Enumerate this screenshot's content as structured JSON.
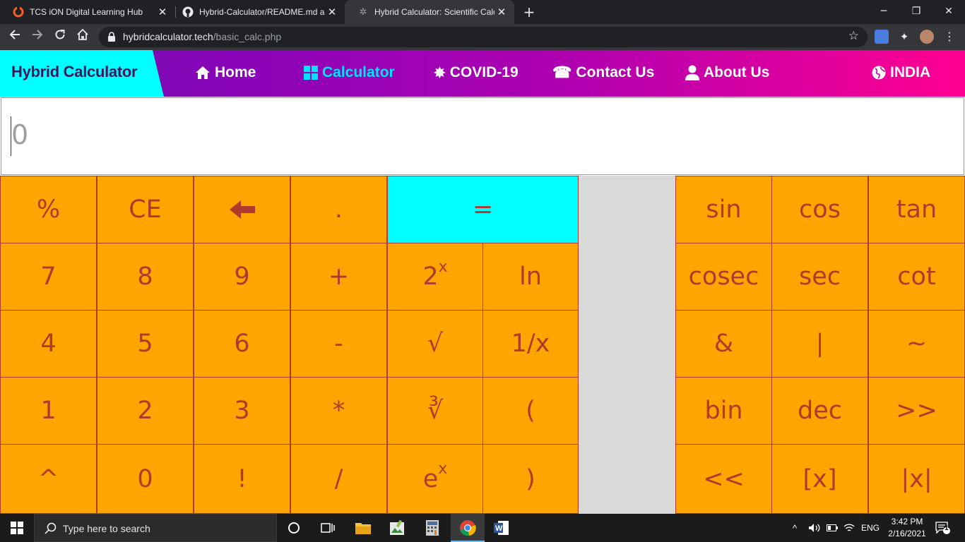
{
  "browser": {
    "tabs": [
      {
        "title": "TCS iON Digital Learning Hub",
        "favicon": "tcs-ion-icon"
      },
      {
        "title": "Hybrid-Calculator/README.md a",
        "favicon": "github-icon"
      },
      {
        "title": "Hybrid Calculator: Scientific Calcu",
        "favicon": "site-icon",
        "active": true
      }
    ],
    "new_tab": "+",
    "url_domain": "hybridcalculator.tech",
    "url_path": "/basic_calc.php",
    "window_controls": [
      "─",
      "❐",
      "✕"
    ]
  },
  "site": {
    "brand": "Hybrid Calculator",
    "nav": [
      {
        "label": "Home",
        "icon": "home-icon"
      },
      {
        "label": "Calculator",
        "icon": "grid-icon",
        "active": true
      },
      {
        "label": "COVID-19",
        "icon": "virus-icon"
      },
      {
        "label": "Contact Us",
        "icon": "phone-icon"
      },
      {
        "label": "About Us",
        "icon": "user-icon"
      },
      {
        "label": "INDIA",
        "icon": "globe-icon"
      }
    ],
    "display_value": "0",
    "colors": {
      "key_bg": "#ffa500",
      "key_text": "#b03a2e",
      "equals_bg": "#00ffff",
      "brand_bg": "#00ffff",
      "active_nav": "#00e5ff"
    }
  },
  "keys": {
    "row1": [
      "%",
      "CE",
      "backspace",
      ".",
      "="
    ],
    "row2": [
      "7",
      "8",
      "9",
      "+",
      "2",
      "ln"
    ],
    "row2_sup": "x",
    "row3": [
      "4",
      "5",
      "6",
      "-",
      "√",
      "1/x"
    ],
    "row4": [
      "1",
      "2",
      "3",
      "*",
      "∛",
      "("
    ],
    "row5": [
      "^",
      "0",
      "!",
      "/",
      "e",
      ")"
    ],
    "row5_sup": "x",
    "sci": [
      [
        "sin",
        "cos",
        "tan"
      ],
      [
        "cosec",
        "sec",
        "cot"
      ],
      [
        "&",
        "|",
        "~"
      ],
      [
        "bin",
        "dec",
        ">>"
      ],
      [
        "<<",
        "[x]",
        "|x|"
      ]
    ]
  },
  "taskbar": {
    "search_placeholder": "Type here to search",
    "lang": "ENG",
    "time": "3:42 PM",
    "date": "2/16/2021",
    "notifications": "1"
  }
}
